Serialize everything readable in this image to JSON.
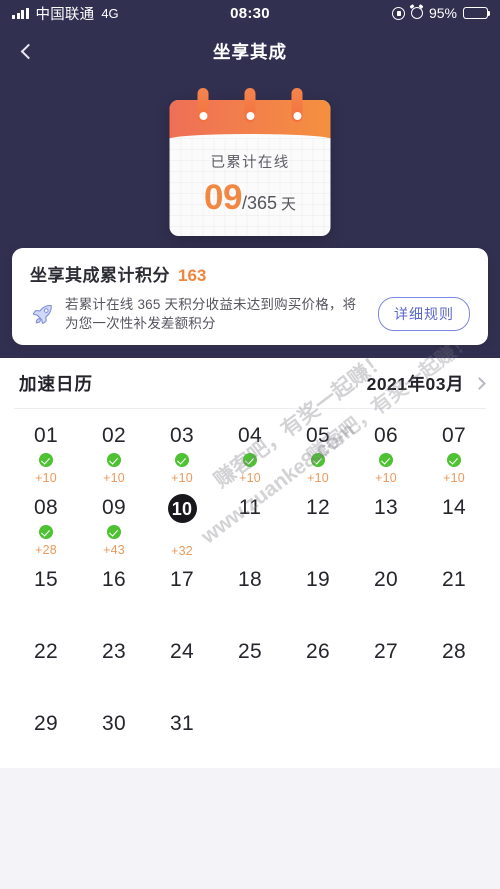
{
  "statusbar": {
    "carrier": "中国联通",
    "network": "4G",
    "time": "08:30",
    "battery_pct": "95%",
    "signal_icon": "signal-bars-icon",
    "lock_rotation_icon": "lock-rotation-icon",
    "alarm_icon": "alarm-clock-icon",
    "battery_icon": "battery-icon"
  },
  "navbar": {
    "back_icon": "chevron-left-icon",
    "title": "坐享其成"
  },
  "hero": {
    "background_color": "#323050",
    "calendar_illustration": {
      "label": "已累计在线",
      "days_done": "09",
      "days_total": "/365",
      "unit": "天",
      "accent_color": "#f08844",
      "header_gradient_from": "#ef6f57",
      "header_gradient_to": "#f5903f"
    }
  },
  "points_card": {
    "title": "坐享其成累计积分",
    "score": "163",
    "score_color": "#f2853c",
    "rocket_icon": "rocket-icon",
    "description": "若累计在线 365 天积分收益未达到购买价格，将为您一次性补发差额积分",
    "rule_button": "详细规则",
    "rule_button_color": "#5b69c9"
  },
  "calendar": {
    "section_title": "加速日历",
    "month_label": "2021年03月",
    "chevron_icon": "chevron-right-icon",
    "check_icon": "check-circle-icon",
    "check_color": "#4fc234",
    "bonus_color": "#e99a5c",
    "today_bg_color": "#17171c",
    "days": [
      {
        "num": "01",
        "checked": true,
        "bonus": "+10",
        "today": false
      },
      {
        "num": "02",
        "checked": true,
        "bonus": "+10",
        "today": false
      },
      {
        "num": "03",
        "checked": true,
        "bonus": "+10",
        "today": false
      },
      {
        "num": "04",
        "checked": true,
        "bonus": "+10",
        "today": false
      },
      {
        "num": "05",
        "checked": true,
        "bonus": "+10",
        "today": false
      },
      {
        "num": "06",
        "checked": true,
        "bonus": "+10",
        "today": false
      },
      {
        "num": "07",
        "checked": true,
        "bonus": "+10",
        "today": false
      },
      {
        "num": "08",
        "checked": true,
        "bonus": "+28",
        "today": false
      },
      {
        "num": "09",
        "checked": true,
        "bonus": "+43",
        "today": false
      },
      {
        "num": "10",
        "checked": false,
        "bonus": "+32",
        "today": true
      },
      {
        "num": "11",
        "checked": false,
        "bonus": "",
        "today": false
      },
      {
        "num": "12",
        "checked": false,
        "bonus": "",
        "today": false
      },
      {
        "num": "13",
        "checked": false,
        "bonus": "",
        "today": false
      },
      {
        "num": "14",
        "checked": false,
        "bonus": "",
        "today": false
      },
      {
        "num": "15",
        "checked": false,
        "bonus": "",
        "today": false
      },
      {
        "num": "16",
        "checked": false,
        "bonus": "",
        "today": false
      },
      {
        "num": "17",
        "checked": false,
        "bonus": "",
        "today": false
      },
      {
        "num": "18",
        "checked": false,
        "bonus": "",
        "today": false
      },
      {
        "num": "19",
        "checked": false,
        "bonus": "",
        "today": false
      },
      {
        "num": "20",
        "checked": false,
        "bonus": "",
        "today": false
      },
      {
        "num": "21",
        "checked": false,
        "bonus": "",
        "today": false
      },
      {
        "num": "22",
        "checked": false,
        "bonus": "",
        "today": false
      },
      {
        "num": "23",
        "checked": false,
        "bonus": "",
        "today": false
      },
      {
        "num": "24",
        "checked": false,
        "bonus": "",
        "today": false
      },
      {
        "num": "25",
        "checked": false,
        "bonus": "",
        "today": false
      },
      {
        "num": "26",
        "checked": false,
        "bonus": "",
        "today": false
      },
      {
        "num": "27",
        "checked": false,
        "bonus": "",
        "today": false
      },
      {
        "num": "28",
        "checked": false,
        "bonus": "",
        "today": false
      },
      {
        "num": "29",
        "checked": false,
        "bonus": "",
        "today": false
      },
      {
        "num": "30",
        "checked": false,
        "bonus": "",
        "today": false
      },
      {
        "num": "31",
        "checked": false,
        "bonus": "",
        "today": false
      }
    ]
  },
  "watermark": {
    "line1": "赚客吧，有奖一起赚！",
    "line2": "www.zuanke8.com"
  }
}
